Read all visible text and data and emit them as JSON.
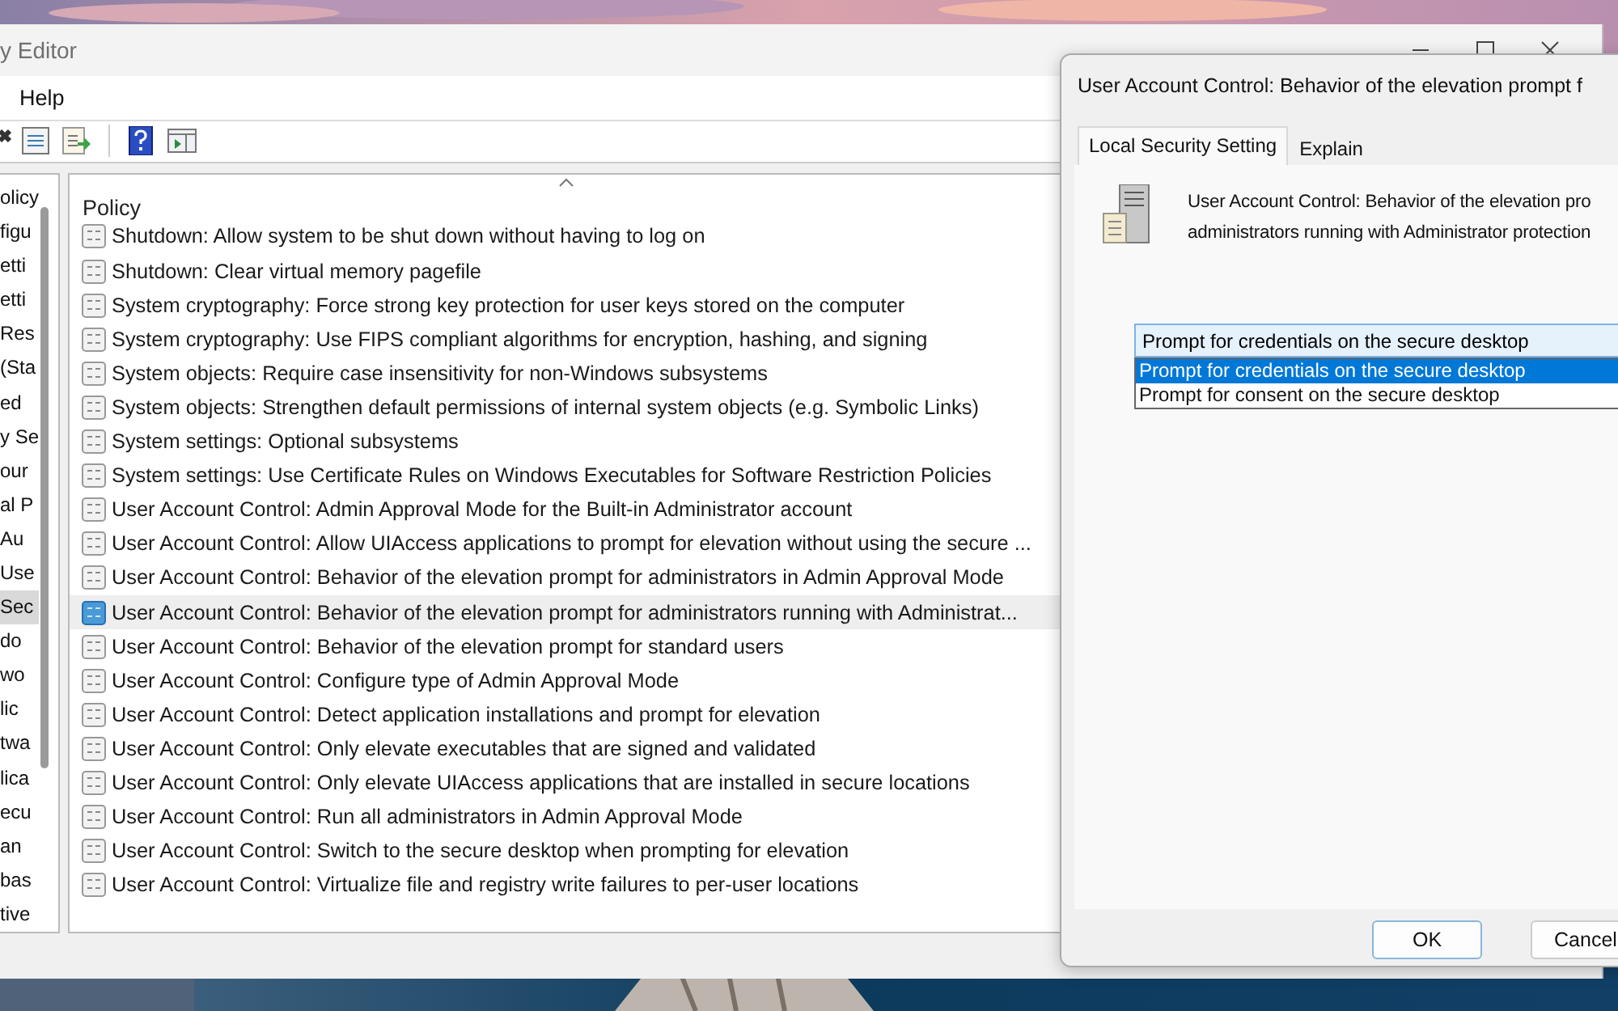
{
  "main_window": {
    "title": "y Editor",
    "menu": [
      "Help"
    ],
    "tree": {
      "items": [
        {
          "label": "olicy",
          "selected": false
        },
        {
          "label": "figu",
          "selected": false
        },
        {
          "label": "etti",
          "selected": false
        },
        {
          "label": "etti",
          "selected": false
        },
        {
          "label": "Res",
          "selected": false
        },
        {
          "label": "(Sta",
          "selected": false
        },
        {
          "label": "ed",
          "selected": false
        },
        {
          "label": "y Se",
          "selected": false
        },
        {
          "label": "our",
          "selected": false
        },
        {
          "label": "al P",
          "selected": false
        },
        {
          "label": "Au",
          "selected": false
        },
        {
          "label": "Use",
          "selected": false
        },
        {
          "label": "Sec",
          "selected": true
        },
        {
          "label": "do",
          "selected": false
        },
        {
          "label": "wo",
          "selected": false
        },
        {
          "label": "lic",
          "selected": false
        },
        {
          "label": "twa",
          "selected": false
        },
        {
          "label": "lica",
          "selected": false
        },
        {
          "label": "ecu",
          "selected": false
        },
        {
          "label": "an",
          "selected": false
        },
        {
          "label": "bas",
          "selected": false
        },
        {
          "label": "tive",
          "selected": false
        }
      ]
    },
    "policy_list": {
      "column": "Policy",
      "rows": [
        {
          "label": "Shutdown: Allow system to be shut down without having to log on",
          "selected": false
        },
        {
          "label": "Shutdown: Clear virtual memory pagefile",
          "selected": false
        },
        {
          "label": "System cryptography: Force strong key protection for user keys stored on the computer",
          "selected": false
        },
        {
          "label": "System cryptography: Use FIPS compliant algorithms for encryption, hashing, and signing",
          "selected": false
        },
        {
          "label": "System objects: Require case insensitivity for non-Windows subsystems",
          "selected": false
        },
        {
          "label": "System objects: Strengthen default permissions of internal system objects (e.g. Symbolic Links)",
          "selected": false
        },
        {
          "label": "System settings: Optional subsystems",
          "selected": false
        },
        {
          "label": "System settings: Use Certificate Rules on Windows Executables for Software Restriction Policies",
          "selected": false
        },
        {
          "label": "User Account Control: Admin Approval Mode for the Built-in Administrator account",
          "selected": false
        },
        {
          "label": "User Account Control: Allow UIAccess applications to prompt for elevation without using the secure ...",
          "selected": false
        },
        {
          "label": "User Account Control: Behavior of the elevation prompt for administrators in Admin Approval Mode",
          "selected": false
        },
        {
          "label": "User Account Control: Behavior of the elevation prompt for administrators running with Administrat...",
          "selected": true
        },
        {
          "label": "User Account Control: Behavior of the elevation prompt for standard users",
          "selected": false
        },
        {
          "label": "User Account Control: Configure type of Admin Approval Mode",
          "selected": false
        },
        {
          "label": "User Account Control: Detect application installations and prompt for elevation",
          "selected": false
        },
        {
          "label": "User Account Control: Only elevate executables that are signed and validated",
          "selected": false
        },
        {
          "label": "User Account Control: Only elevate UIAccess applications that are installed in secure locations",
          "selected": false
        },
        {
          "label": "User Account Control: Run all administrators in Admin Approval Mode",
          "selected": false
        },
        {
          "label": "User Account Control: Switch to the secure desktop when prompting for elevation",
          "selected": false
        },
        {
          "label": "User Account Control: Virtualize file and registry write failures to per-user locations",
          "selected": false
        }
      ]
    }
  },
  "dialog": {
    "title": "User Account Control: Behavior of the elevation prompt f",
    "tabs": [
      {
        "label": "Local Security Setting",
        "selected": true
      },
      {
        "label": "Explain",
        "selected": false
      }
    ],
    "description": [
      "User Account Control: Behavior of the elevation pro",
      "administrators running with Administrator protection"
    ],
    "dropdown": {
      "value": "Prompt for credentials on the secure desktop",
      "options": [
        {
          "label": "Prompt for credentials on the secure desktop",
          "selected": true
        },
        {
          "label": "Prompt for consent on the secure desktop",
          "selected": false
        }
      ]
    },
    "buttons": [
      "OK",
      "Cancel"
    ]
  }
}
